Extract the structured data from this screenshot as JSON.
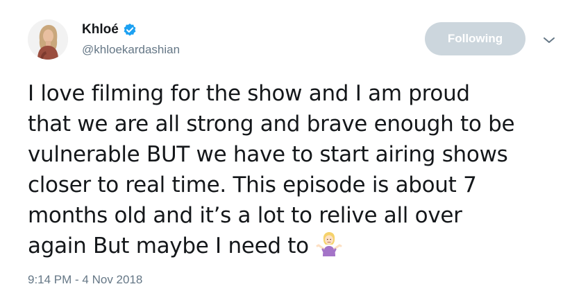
{
  "author": {
    "display_name": "Khloé",
    "handle": "@khloekardashian",
    "verified": true,
    "avatar_icon": "profile-photo"
  },
  "follow_button": {
    "label": "Following",
    "background": "#ccd6dd"
  },
  "menu": {
    "icon": "chevron-down-icon"
  },
  "tweet": {
    "lines": [
      "I love filming for the show and I am proud",
      "that we are all strong and brave enough to be",
      "vulnerable BUT we have to start airing shows",
      "closer to real time. This episode is about 7",
      "months old and it’s a lot to relive all over",
      "again But maybe I need to"
    ],
    "trailing_emoji": "person-shrugging-emoji",
    "timestamp": "9:14 PM - 4 Nov 2018"
  },
  "colors": {
    "text": "#14171a",
    "secondary_text": "#657786",
    "verified_blue": "#1da1f2"
  }
}
